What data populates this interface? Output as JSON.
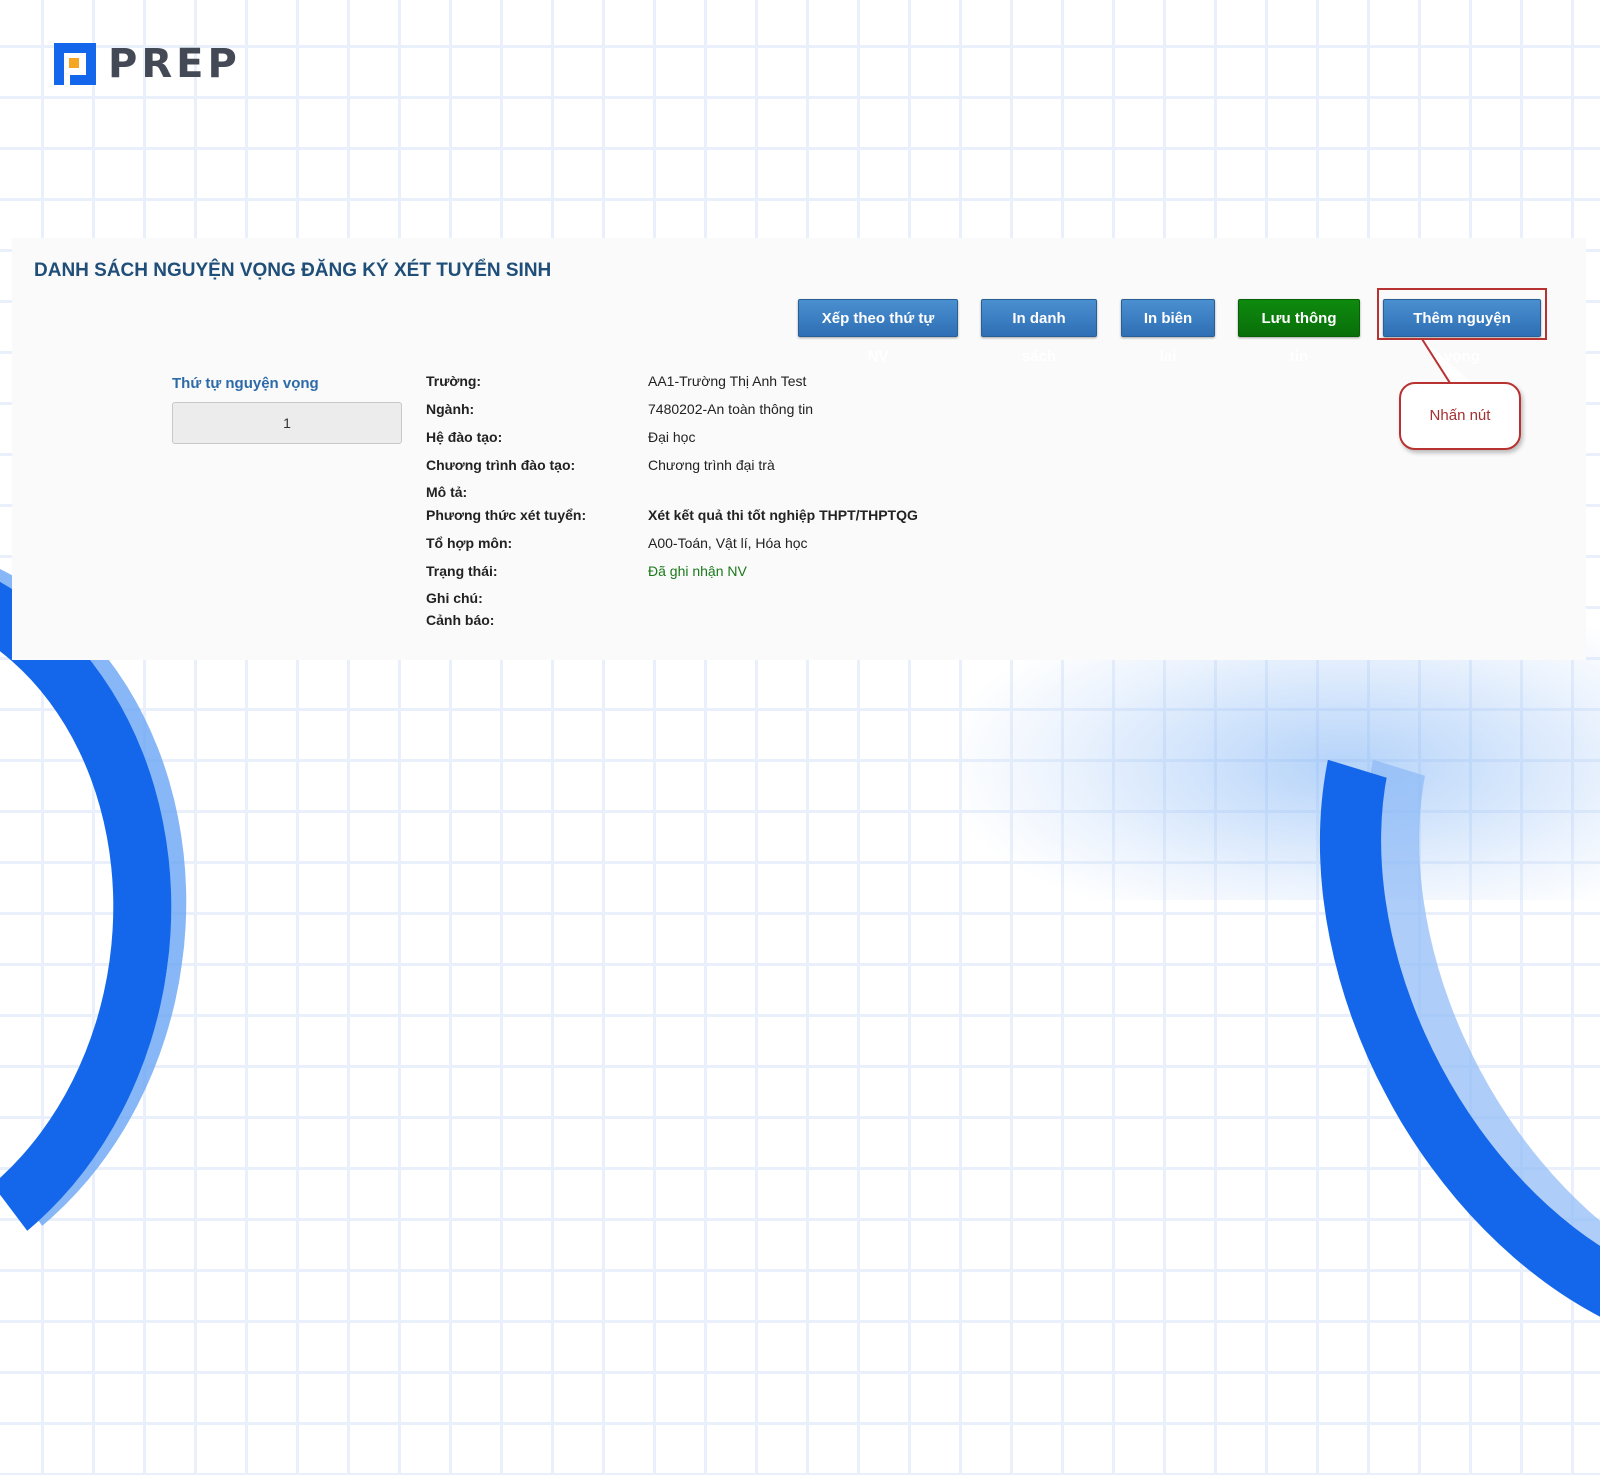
{
  "brand": {
    "name": "PREP"
  },
  "page": {
    "title": "DANH SÁCH NGUYỆN VỌNG ĐĂNG KÝ XÉT TUYỂN SINH"
  },
  "toolbar": {
    "sort_label": "Xếp theo thứ tự NV",
    "print_list_label": "In danh sách",
    "print_receipt_label": "In biên lai",
    "save_label": "Lưu thông tin",
    "add_label": "Thêm nguyện vọng"
  },
  "callout": {
    "text": "Nhấn nút"
  },
  "order": {
    "label": "Thứ tự nguyện vọng",
    "value": "1"
  },
  "details": [
    {
      "key": "Trường:",
      "value": "AA1-Trường Thị Anh Test"
    },
    {
      "key": "Ngành:",
      "value": "7480202-An toàn thông tin"
    },
    {
      "key": "Hệ đào tạo:",
      "value": "Đại học"
    },
    {
      "key": "Chương trình đào tạo:",
      "value": "Chương trình đại trà"
    },
    {
      "key": "Mô tả:",
      "value": ""
    },
    {
      "key": "Phương thức xét tuyển:",
      "value": "Xét kết quả thi tốt nghiệp THPT/THPTQG"
    },
    {
      "key": "Tổ hợp môn:",
      "value": "A00-Toán, Vật lí, Hóa học"
    },
    {
      "key": "Trạng thái:",
      "value": "Đã ghi nhận NV"
    },
    {
      "key": "Ghi chú:",
      "value": ""
    },
    {
      "key": "Cảnh báo:",
      "value": ""
    }
  ],
  "colors": {
    "accent_blue": "#1467ea",
    "button_blue": "#2f6fb5",
    "button_green": "#096f09",
    "title_color": "#1f4e79",
    "highlight_red": "#b83232",
    "status_green": "#1a7a1a"
  }
}
